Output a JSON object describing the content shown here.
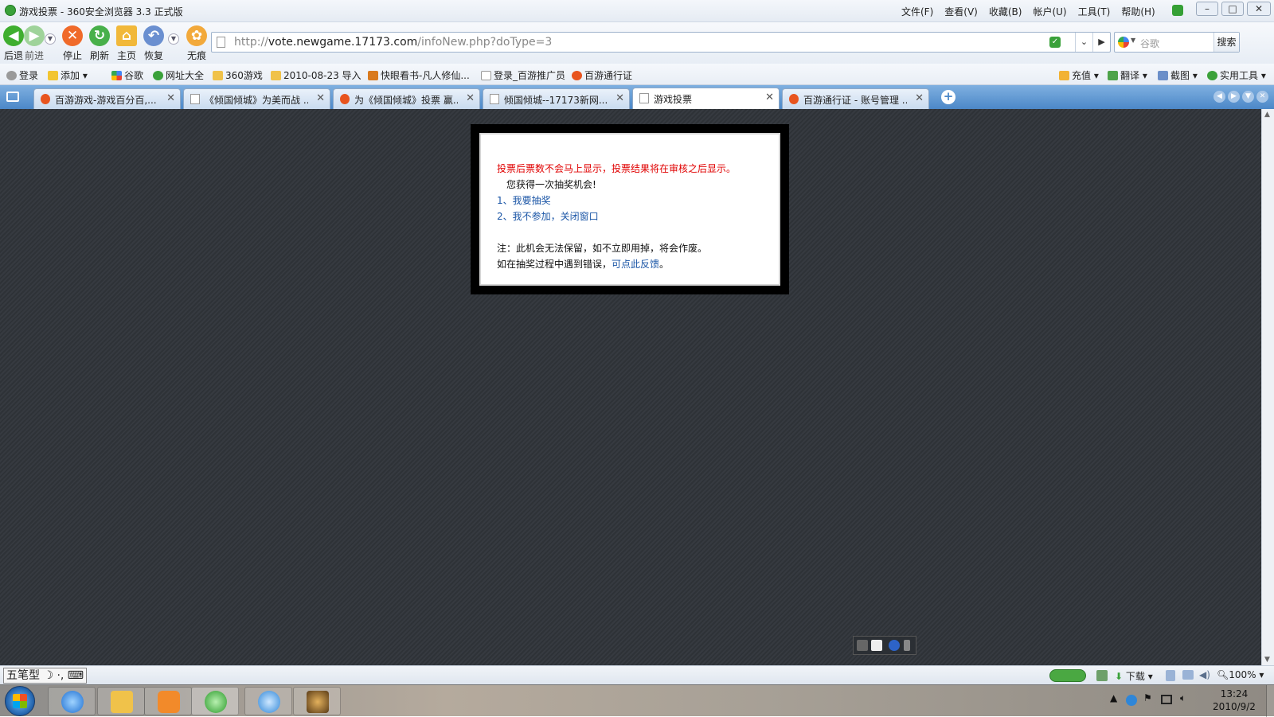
{
  "window": {
    "title": "游戏投票 - 360安全浏览器 3.3 正式版",
    "menus": [
      "文件(F)",
      "查看(V)",
      "收藏(B)",
      "帐户(U)",
      "工具(T)",
      "帮助(H)"
    ],
    "controls": {
      "minimize": "–",
      "maximize": "□",
      "close": "✕"
    }
  },
  "toolbar": {
    "back": "后退",
    "forward": "前进",
    "stop": "停止",
    "refresh": "刷新",
    "home": "主页",
    "restore": "恢复",
    "incognito": "无痕"
  },
  "address": {
    "url_prefix": "http://",
    "url_host": "vote.newgame.17173.com",
    "url_path": "/infoNew.php?doType=3"
  },
  "search": {
    "placeholder": "谷歌",
    "button": "搜索"
  },
  "favorites": {
    "items": [
      "登录",
      "添加",
      "谷歌",
      "网址大全",
      "360游戏",
      "2010-08-23 导入",
      "快眼看书-凡人修仙...",
      "登录_百游推广员",
      "百游通行证"
    ],
    "right_tools": [
      "充值",
      "翻译",
      "截图",
      "实用工具"
    ]
  },
  "tabs": [
    {
      "label": "百游游戏-游戏百分百,...",
      "active": false
    },
    {
      "label": "《倾国倾城》为美而战 ...",
      "active": false
    },
    {
      "label": "为《倾国倾城》投票 赢...",
      "active": false
    },
    {
      "label": "倾国倾城--17173新网...",
      "active": false
    },
    {
      "label": "游戏投票",
      "active": true
    },
    {
      "label": "百游通行证 - 账号管理 ...",
      "active": false
    }
  ],
  "dialog": {
    "notice": "投票后票数不会马上显示，投票结果将在审核之后显示。",
    "chance": "您获得一次抽奖机会!",
    "option1": "1、我要抽奖",
    "option2": "2、我不参加，关闭窗口",
    "note": "注：此机会无法保留，如不立即用掉，将会作废。",
    "feedback_prefix": "如在抽奖过程中遇到错误，",
    "feedback_link": "可点此反馈",
    "feedback_suffix": "。"
  },
  "statusbar": {
    "ime": "五笔型",
    "download": "下载",
    "zoom": "100%"
  },
  "taskbar": {
    "time": "13:24",
    "date": "2010/9/2"
  },
  "colors": {
    "notice_red": "#e00000",
    "link_blue": "#1a55a6",
    "page_bg": "#33373c",
    "tabbar_blue": "#4c88c8"
  }
}
